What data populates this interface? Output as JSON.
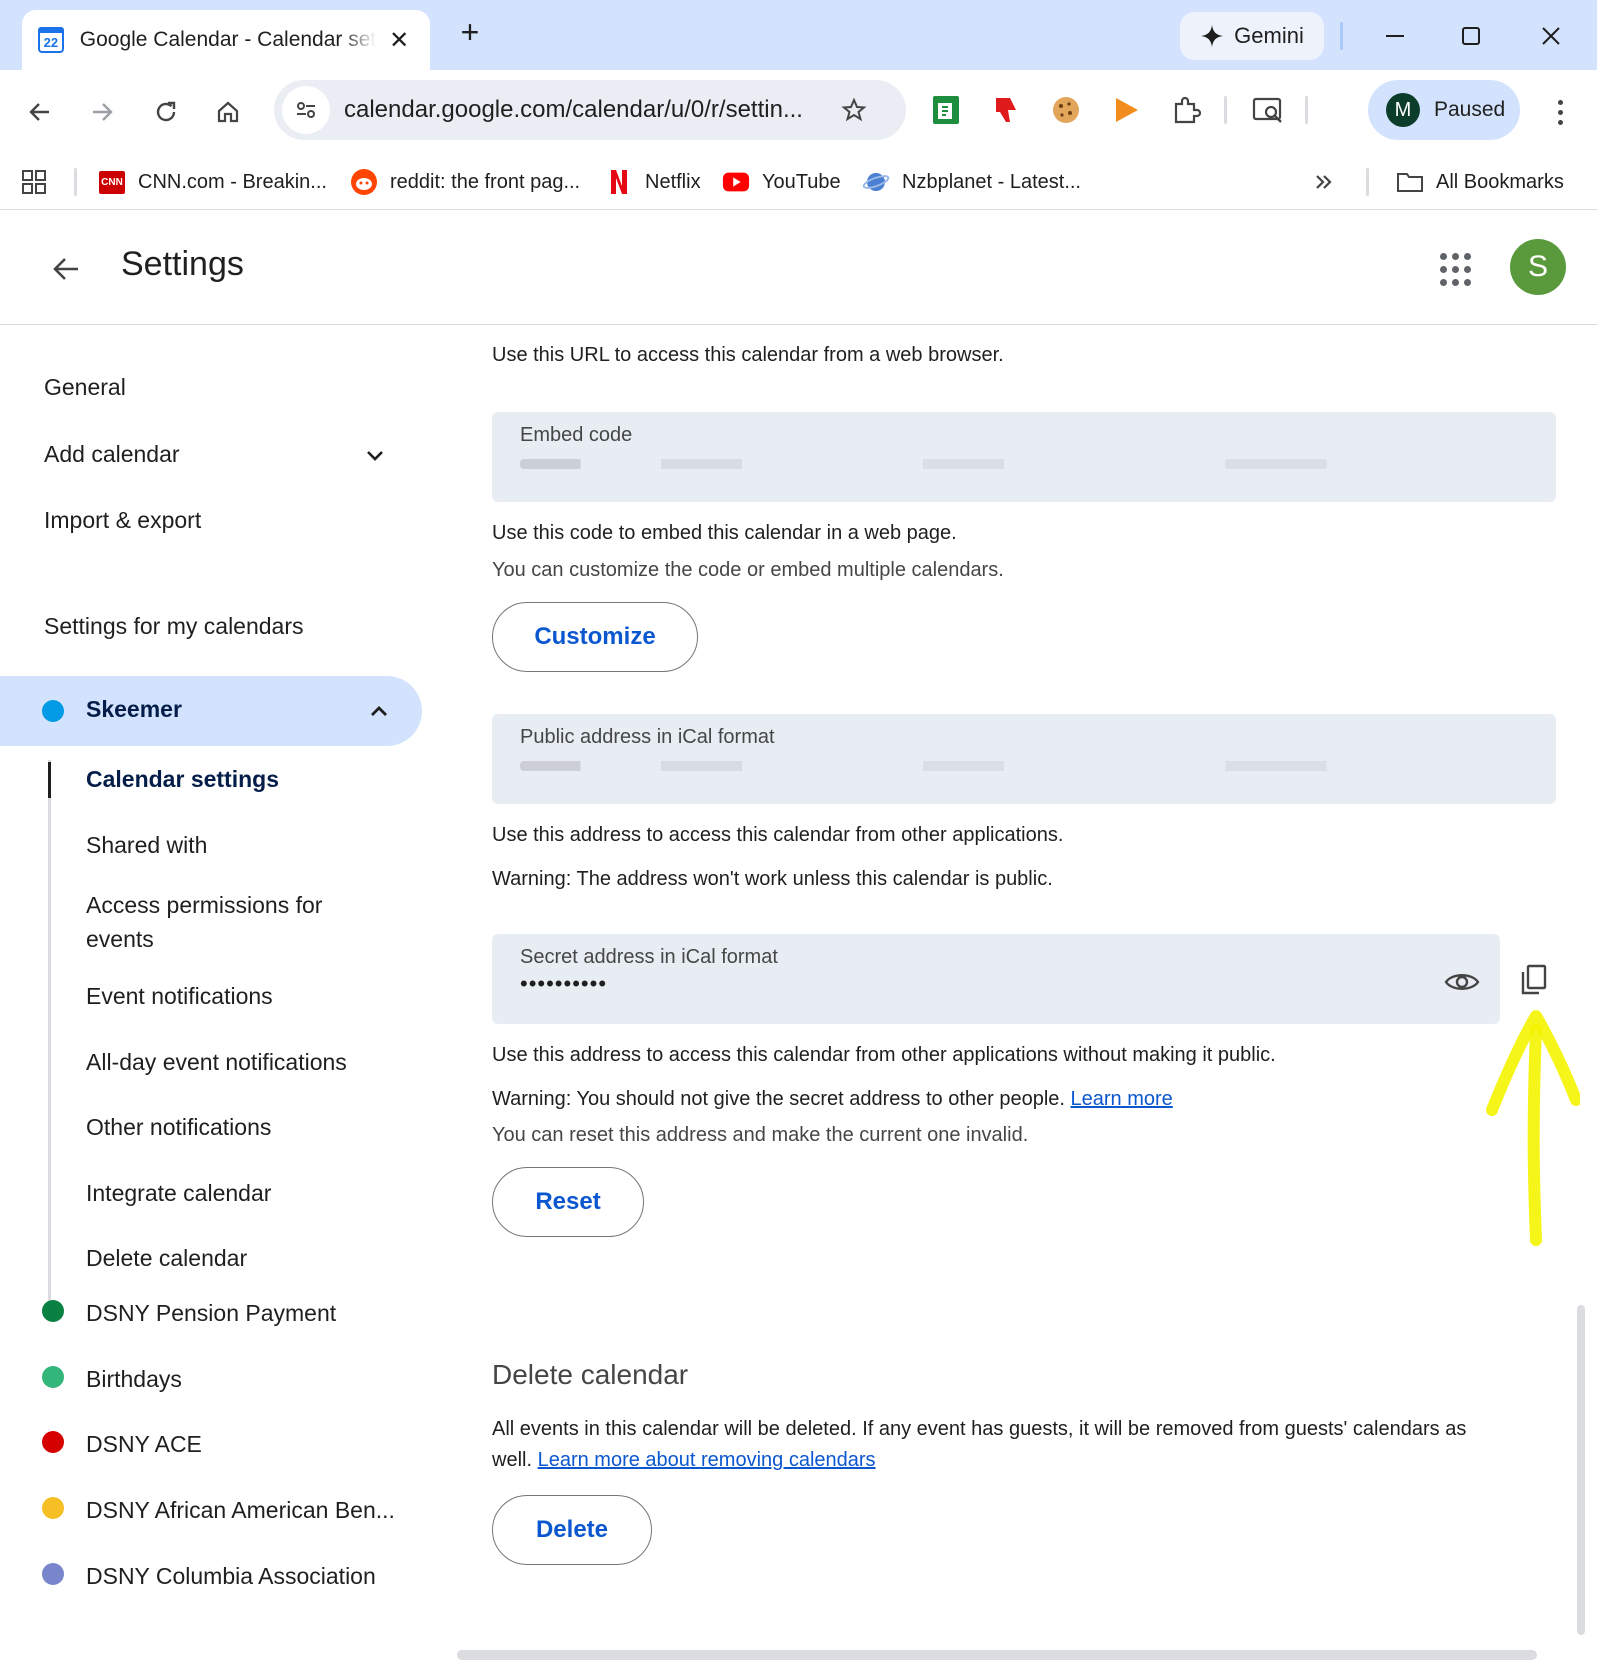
{
  "browser": {
    "tab_title": "Google Calendar - Calendar settings",
    "tab_favicon_text": "22",
    "gemini_label": "Gemini",
    "url": "calendar.google.com/calendar/u/0/r/settin...",
    "profile_initial": "M",
    "profile_status": "Paused",
    "bookmarks": [
      {
        "label": "CNN.com - Breakin...",
        "icon": "cnn-icon"
      },
      {
        "label": "reddit: the front pag...",
        "icon": "reddit-icon"
      },
      {
        "label": "Netflix",
        "icon": "netflix-icon"
      },
      {
        "label": "YouTube",
        "icon": "youtube-icon"
      },
      {
        "label": "Nzbplanet - Latest...",
        "icon": "nzbplanet-icon"
      }
    ],
    "cnn_badge": "CNN",
    "all_bookmarks": "All Bookmarks"
  },
  "app": {
    "title": "Settings",
    "user_initial": "S"
  },
  "sidebar": {
    "items": [
      "General",
      "Add calendar",
      "Import & export"
    ],
    "section_title": "Settings for my calendars",
    "selected_calendar": {
      "name": "Skeemer",
      "color": "#039be5"
    },
    "sub_items": [
      "Calendar settings",
      "Shared with",
      "Access permissions for events",
      "Event notifications",
      "All-day event notifications",
      "Other notifications",
      "Integrate calendar",
      "Delete calendar"
    ],
    "other_calendars": [
      {
        "name": "DSNY Pension Payment",
        "color": "#0b8043"
      },
      {
        "name": "Birthdays",
        "color": "#33b679"
      },
      {
        "name": "DSNY ACE",
        "color": "#d50000"
      },
      {
        "name": "DSNY African American Ben...",
        "color": "#f6bf26"
      },
      {
        "name": "DSNY Columbia Association",
        "color": "#7986cb"
      }
    ]
  },
  "main": {
    "public_url_help": "Use this URL to access this calendar from a web browser.",
    "embed_label": "Embed code",
    "embed_help_1": "Use this code to embed this calendar in a web page.",
    "embed_help_2": "You can customize the code or embed multiple calendars.",
    "customize_button": "Customize",
    "public_ical_label": "Public address in iCal format",
    "public_ical_help": "Use this address to access this calendar from other applications.",
    "public_ical_warning": "Warning: The address won't work unless this calendar is public.",
    "secret_ical_label": "Secret address in iCal format",
    "secret_ical_value": "••••••••••",
    "secret_help": "Use this address to access this calendar from other applications without making it public.",
    "secret_warning": "Warning: You should not give the secret address to other people.",
    "learn_more": "Learn more",
    "reset_help": "You can reset this address and make the current one invalid.",
    "reset_button": "Reset",
    "delete_title": "Delete calendar",
    "delete_help_1": "All events in this calendar will be deleted. If any event has guests, it will be removed from guests' calendars as",
    "delete_help_2": "well.",
    "delete_link": "Learn more about removing calendars",
    "delete_button": "Delete"
  },
  "colors": {
    "accent": "#0b57d0",
    "annotation": "#f4f400"
  }
}
